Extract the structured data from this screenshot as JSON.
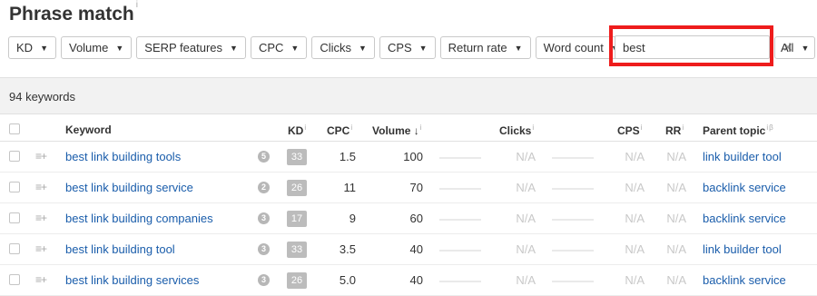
{
  "title": "Phrase match",
  "title_info": "i",
  "filters": [
    {
      "name": "filter-kd",
      "label": "KD"
    },
    {
      "name": "filter-volume",
      "label": "Volume"
    },
    {
      "name": "filter-serp-features",
      "label": "SERP features"
    },
    {
      "name": "filter-cpc",
      "label": "CPC"
    },
    {
      "name": "filter-clicks",
      "label": "Clicks"
    },
    {
      "name": "filter-cps",
      "label": "CPS"
    },
    {
      "name": "filter-return-rate",
      "label": "Return rate"
    },
    {
      "name": "filter-word-count",
      "label": "Word count"
    }
  ],
  "search": {
    "value": "best",
    "clear_icon": "close-icon"
  },
  "scope_filter": {
    "label": "All"
  },
  "summary": "94 keywords",
  "columns": {
    "keyword": "Keyword",
    "kd": "KD",
    "cpc": "CPC",
    "volume": "Volume",
    "volume_sort": "↓",
    "clicks": "Clicks",
    "cps": "CPS",
    "rr": "RR",
    "parent_topic": "Parent topic",
    "info": "i",
    "beta": "β"
  },
  "rows": [
    {
      "keyword": "best link building tools",
      "serp": "5",
      "kd": "33",
      "cpc": "1.5",
      "volume": "100",
      "clicks": "N/A",
      "cps": "N/A",
      "rr": "N/A",
      "parent_topic": "link builder tool"
    },
    {
      "keyword": "best link building service",
      "serp": "2",
      "kd": "26",
      "cpc": "11",
      "volume": "70",
      "clicks": "N/A",
      "cps": "N/A",
      "rr": "N/A",
      "parent_topic": "backlink service"
    },
    {
      "keyword": "best link building companies",
      "serp": "3",
      "kd": "17",
      "cpc": "9",
      "volume": "60",
      "clicks": "N/A",
      "cps": "N/A",
      "rr": "N/A",
      "parent_topic": "backlink service"
    },
    {
      "keyword": "best link building tool",
      "serp": "3",
      "kd": "33",
      "cpc": "3.5",
      "volume": "40",
      "clicks": "N/A",
      "cps": "N/A",
      "rr": "N/A",
      "parent_topic": "link builder tool"
    },
    {
      "keyword": "best link building services",
      "serp": "3",
      "kd": "26",
      "cpc": "5.0",
      "volume": "40",
      "clicks": "N/A",
      "cps": "N/A",
      "rr": "N/A",
      "parent_topic": "backlink service"
    }
  ]
}
